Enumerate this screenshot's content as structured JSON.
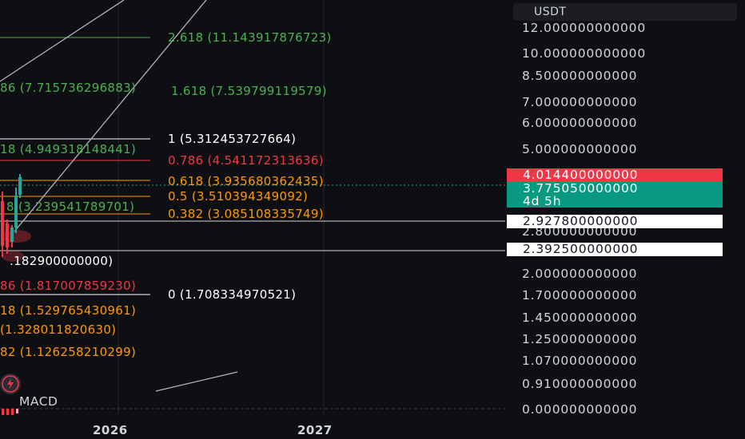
{
  "price_scale": {
    "currency": "USDT",
    "ticks": [
      "12.000000000000",
      "10.000000000000",
      "8.500000000000",
      "7.000000000000",
      "6.000000000000",
      "5.000000000000",
      "2.800000000000",
      "2.000000000000",
      "1.700000000000",
      "1.450000000000",
      "1.250000000000",
      "1.070000000000",
      "0.910000000000",
      "0.000000000000"
    ],
    "tags": {
      "high_price": "4.014400000000",
      "last_price": "3.775050000000",
      "countdown": "4d 5h",
      "hline_1": "2.927800000000",
      "hline_2": "2.392500000000"
    }
  },
  "fib_right": [
    {
      "text": "2.618 (11.143917876723)",
      "color": "#4caf50"
    },
    {
      "text": "1.618 (7.539799119579)",
      "color": "#4caf50"
    },
    {
      "text": "1 (5.312453727664)",
      "color": "#ffffff"
    },
    {
      "text": "0.786 (4.541172313636)",
      "color": "#f23645"
    },
    {
      "text": "0.618 (3.935680362435)",
      "color": "#ff9800"
    },
    {
      "text": "0.5 (3.510394349092)",
      "color": "#ff9800"
    },
    {
      "text": "0.382 (3.085108335749)",
      "color": "#ff9800"
    },
    {
      "text": "0 (1.708334970521)",
      "color": "#ffffff"
    }
  ],
  "fib_left": [
    {
      "text": "86 (7.715736296883)",
      "color": "#4caf50"
    },
    {
      "text": "18 (4.949318148441)",
      "color": "#4caf50"
    },
    {
      "text": "8 (3.239541789701)",
      "color": "#4caf50"
    },
    {
      "text": ".182900000000)",
      "color": "#ffffff"
    },
    {
      "text": "86 (1.817007859230)",
      "color": "#f23645"
    },
    {
      "text": "18 (1.529765430961)",
      "color": "#ff9800"
    },
    {
      "text": "(1.328011820630)",
      "color": "#ff9800"
    },
    {
      "text": "82 (1.126258210299)",
      "color": "#ff9800"
    }
  ],
  "indicator": {
    "name": "MACD"
  },
  "time_axis": {
    "years": [
      "2026",
      "2027"
    ]
  }
}
